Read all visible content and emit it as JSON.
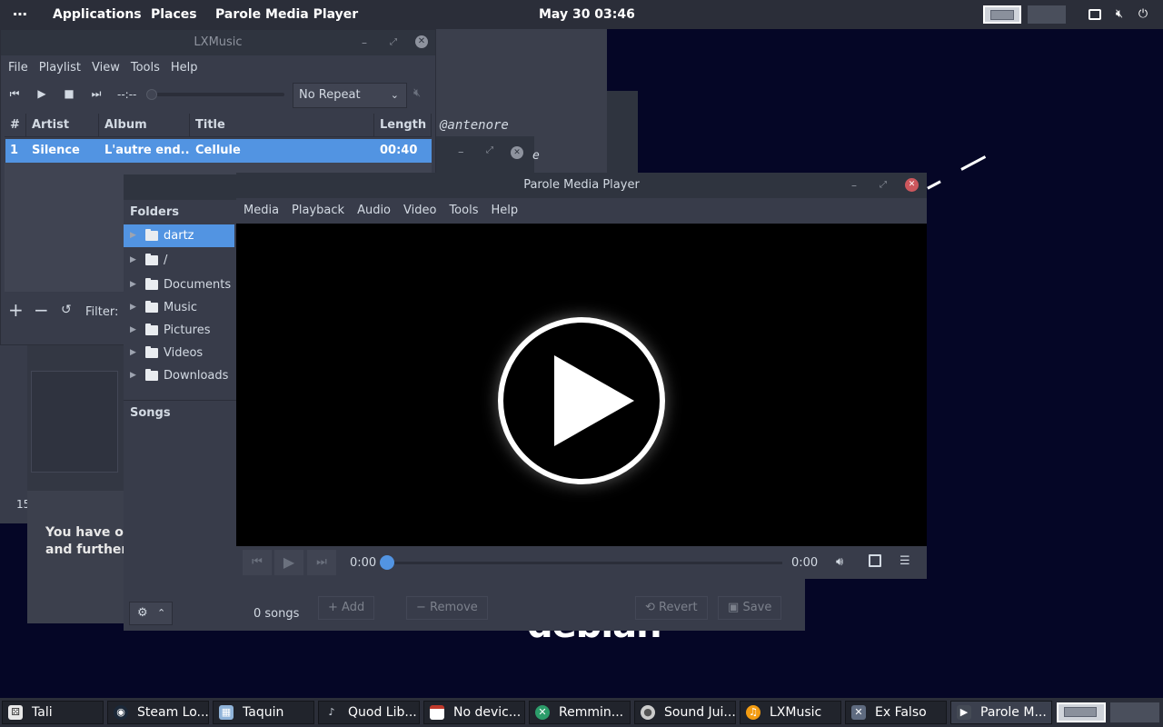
{
  "top_panel": {
    "menu_dots": "⋯",
    "applications": "Applications",
    "places": "Places",
    "active_app": "Parole Media Player",
    "clock": "May 30  03:46"
  },
  "desktop": {
    "username_fragment": "@antenore",
    "fragment_e": "e",
    "panel_number": "15",
    "notice_line1": "You have our",
    "notice_line2": "and further h",
    "wallpaper_text": "debian"
  },
  "lxmusic": {
    "title": "LXMusic",
    "menu": [
      "File",
      "Playlist",
      "View",
      "Tools",
      "Help"
    ],
    "time_display": "--:--",
    "repeat_mode": "No Repeat",
    "columns": [
      "#",
      "Artist",
      "Album",
      "Title",
      "Length"
    ],
    "rows": [
      {
        "num": "1",
        "artist": "Silence",
        "album": "L'autre end...",
        "title": "Cellule",
        "length": "00:40"
      }
    ],
    "filter_label": "Filter:"
  },
  "exfalso": {
    "folders_header": "Folders",
    "folders": [
      "dartz",
      "/",
      "Documents",
      "Music",
      "Pictures",
      "Videos",
      "Downloads"
    ],
    "songs_header": "Songs",
    "songs_count": "0 songs",
    "add_label": "Add",
    "remove_label": "Remove",
    "revert_label": "Revert",
    "save_label": "Save"
  },
  "parole": {
    "title": "Parole Media Player",
    "menu": [
      "Media",
      "Playback",
      "Audio",
      "Video",
      "Tools",
      "Help"
    ],
    "time_current": "0:00",
    "time_total": "0:00",
    "progress": 0
  },
  "taskbar": {
    "tasks": [
      {
        "label": "Tali",
        "icon": "dice-icon",
        "color": "#e8e8e8"
      },
      {
        "label": "Steam Lo...",
        "icon": "steam-icon",
        "color": "#1b2838"
      },
      {
        "label": "Taquin",
        "icon": "taquin-icon",
        "color": "#8fb3d9"
      },
      {
        "label": "Quod Lib...",
        "icon": "headphones-icon",
        "color": "#444a55"
      },
      {
        "label": "No devic...",
        "icon": "device-icon",
        "color": "#c0392b"
      },
      {
        "label": "Remmin...",
        "icon": "remmina-icon",
        "color": "#2c9c6a"
      },
      {
        "label": "Sound Jui...",
        "icon": "cd-icon",
        "color": "#cccccc"
      },
      {
        "label": "LXMusic",
        "icon": "lxmusic-icon",
        "color": "#f39c12"
      },
      {
        "label": "Ex Falso",
        "icon": "exfalso-icon",
        "color": "#5f6b80"
      },
      {
        "label": "Parole M...",
        "icon": "parole-icon",
        "color": "#444a55"
      }
    ]
  },
  "colors": {
    "accent": "#5294e2",
    "panel": "#2b2e39",
    "window": "#383c4a",
    "desktop": "#050626",
    "close_red": "#cc575d"
  }
}
